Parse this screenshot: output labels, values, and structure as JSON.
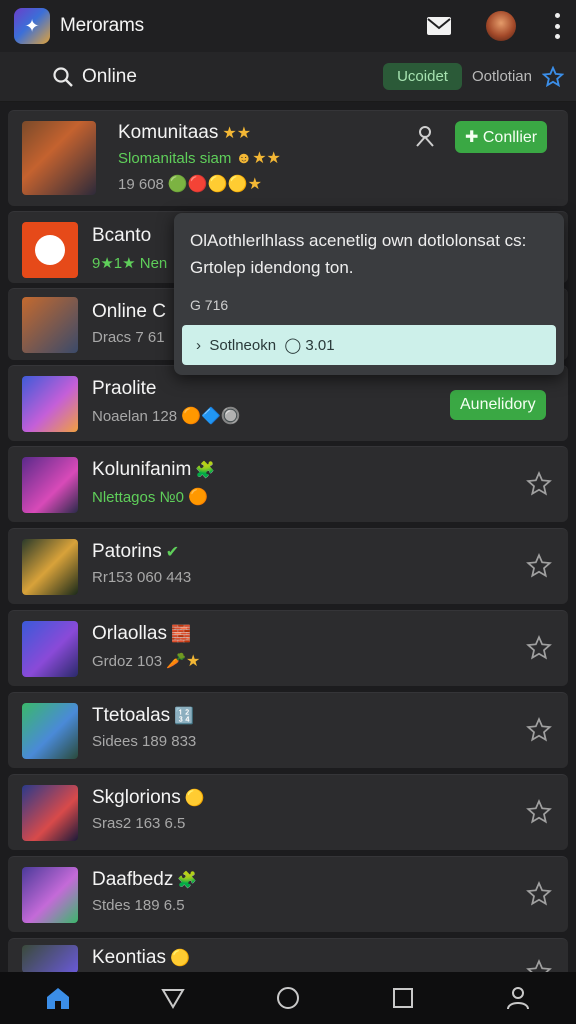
{
  "app": {
    "title": "Merorams"
  },
  "filter": {
    "title": "Online",
    "chip_active": "Ucoidet",
    "chip_plain": "Ootlotian"
  },
  "items": [
    {
      "name": "Komunitaas",
      "sub": "Slomanitals siam",
      "sub2": "19 608",
      "action": "Conllier",
      "sub_green": true
    },
    {
      "name": "Bcanto",
      "sub": "9★1★ Nen",
      "sub_green": true
    },
    {
      "name": "Online C",
      "sub": "Dracs 7 61"
    },
    {
      "name": "Praolite",
      "sub": "Noaelan 128",
      "action": "Aunelidory"
    },
    {
      "name": "Kolunifanim",
      "sub": "Nlettagos №0",
      "sub_green": true
    },
    {
      "name": "Patorins",
      "sub": "Rr153 060 443"
    },
    {
      "name": "Orlaollas",
      "sub": "Grdoz 103"
    },
    {
      "name": "Ttetoalas",
      "sub": "Sidees 189 833"
    },
    {
      "name": "Skglorions",
      "sub": "Sras2 163 6.5"
    },
    {
      "name": "Daafbedz",
      "sub": "Stdes 189 6.5"
    },
    {
      "name": "Keontias",
      "sub": ""
    }
  ],
  "popup": {
    "text": "OlAothlerlhlass acenetlig own dotlolonsat cs: Grtolep idendong ton.",
    "meta": "G 716",
    "action": "Sotlneokn",
    "action_value": "3.01"
  },
  "icons": {
    "mail": "mail-icon",
    "more": "more-icon",
    "search": "search-icon",
    "star": "star-icon",
    "home": "home-icon",
    "back": "back-triangle-icon",
    "circle": "home-circle-icon",
    "square": "recents-square-icon",
    "profile": "profile-icon"
  },
  "colors": {
    "accent_green": "#3aa844",
    "star_blue": "#3b8ee8",
    "background": "#1c1c1e"
  }
}
